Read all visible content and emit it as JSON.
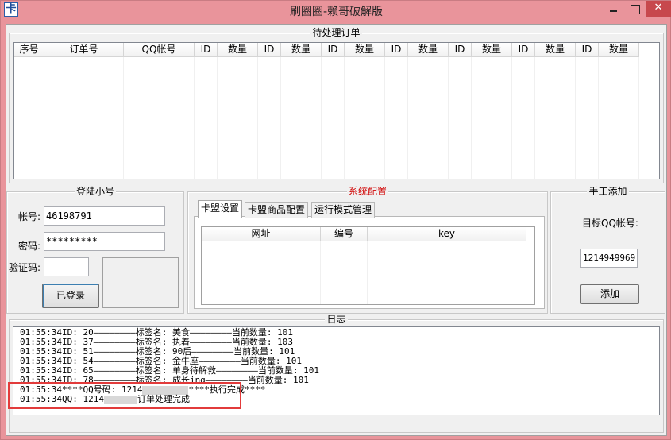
{
  "window": {
    "icon_text": "卡",
    "title": "刷圈圈-赖哥破解版"
  },
  "orders": {
    "title": "待处理订单",
    "columns": [
      "序号",
      "订单号",
      "QQ帐号",
      "ID",
      "数量",
      "ID",
      "数量",
      "ID",
      "数量",
      "ID",
      "数量",
      "ID",
      "数量",
      "ID",
      "数量",
      "ID",
      "数量"
    ]
  },
  "login": {
    "title": "登陆小号",
    "account_label": "帐号:",
    "account_value": "46198791",
    "password_label": "密码:",
    "password_value": "*********",
    "captcha_label": "验证码:",
    "captcha_value": "",
    "login_button": "已登录"
  },
  "config": {
    "title": "系统配置",
    "tabs": [
      "卡盟设置",
      "卡盟商品配置",
      "运行模式管理"
    ],
    "table_columns": [
      "网址",
      "编号",
      "key"
    ]
  },
  "manual": {
    "title": "手工添加",
    "target_label": "目标QQ帐号:",
    "target_value": "1214949969",
    "add_button": "添加"
  },
  "log": {
    "title": "日志",
    "lines": [
      "01:55:34ID: 20————————标签名: 美食————————当前数量: 101",
      "01:55:34ID: 37————————标签名: 执着————————当前数量: 103",
      "01:55:34ID: 51————————标签名: 90后————————当前数量: 101",
      "01:55:34ID: 54————————标签名: 金牛座————————当前数量: 101",
      "01:55:34ID: 65————————标签名: 单身待解救————————当前数量: 101",
      "01:55:34ID: 78————————标签名: 成长ing————————当前数量: 101"
    ],
    "highlight_line1_prefix": "01:55:34****QQ号码: 1214",
    "highlight_line1_suffix": "****执行完成****",
    "highlight_line2_prefix": "01:55:34QQ: 1214",
    "highlight_line2_suffix": "订单处理完成"
  }
}
